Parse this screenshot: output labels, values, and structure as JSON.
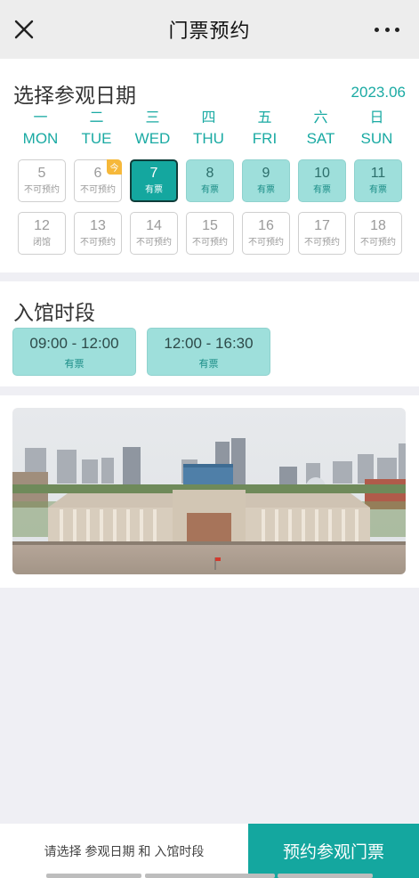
{
  "header": {
    "title": "门票预约"
  },
  "date_section": {
    "title": "选择参观日期",
    "month": "2023.06",
    "weekdays": [
      {
        "cn": "一",
        "en": "MON"
      },
      {
        "cn": "二",
        "en": "TUE"
      },
      {
        "cn": "三",
        "en": "WED"
      },
      {
        "cn": "四",
        "en": "THU"
      },
      {
        "cn": "五",
        "en": "FRI"
      },
      {
        "cn": "六",
        "en": "SAT"
      },
      {
        "cn": "日",
        "en": "SUN"
      }
    ],
    "today_badge": "今",
    "days": [
      {
        "num": "5",
        "status": "不可预约"
      },
      {
        "num": "6",
        "status": "不可预约"
      },
      {
        "num": "7",
        "status": "有票"
      },
      {
        "num": "8",
        "status": "有票"
      },
      {
        "num": "9",
        "status": "有票"
      },
      {
        "num": "10",
        "status": "有票"
      },
      {
        "num": "11",
        "status": "有票"
      },
      {
        "num": "12",
        "status": "闭馆"
      },
      {
        "num": "13",
        "status": "不可预约"
      },
      {
        "num": "14",
        "status": "不可预约"
      },
      {
        "num": "15",
        "status": "不可预约"
      },
      {
        "num": "16",
        "status": "不可预约"
      },
      {
        "num": "17",
        "status": "不可预约"
      },
      {
        "num": "18",
        "status": "不可预约"
      }
    ]
  },
  "slot_section": {
    "title": "入馆时段",
    "slots": [
      {
        "time": "09:00 - 12:00",
        "status": "有票"
      },
      {
        "time": "12:00 - 16:30",
        "status": "有票"
      }
    ]
  },
  "photo": {
    "subject": "museum-building-photo"
  },
  "bottom": {
    "hint": "请选择 参观日期 和 入馆时段",
    "book_label": "预约参观门票"
  },
  "colors": {
    "accent": "#14a79f",
    "available": "#9edfdb",
    "badge": "#f6b83a"
  }
}
